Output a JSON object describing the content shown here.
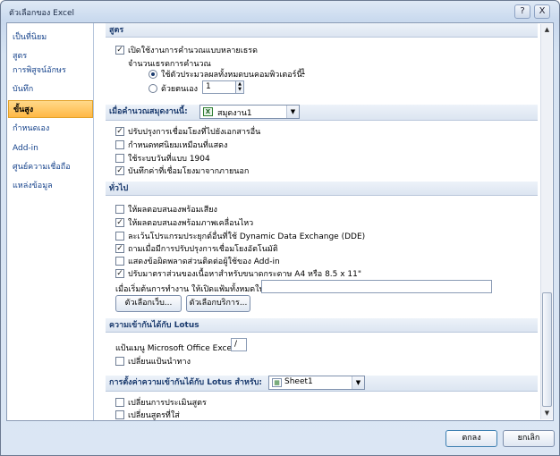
{
  "window": {
    "title": "ตัวเลือกของ Excel",
    "help_glyph": "?",
    "close_glyph": "X"
  },
  "sidebar": {
    "items": [
      {
        "label": "เป็นที่นิยม"
      },
      {
        "label": "สูตร"
      },
      {
        "label": "การพิสูจน์อักษร"
      },
      {
        "label": "บันทึก"
      },
      {
        "label": "ขั้นสูง"
      },
      {
        "label": "กำหนดเอง"
      },
      {
        "label": "Add-in"
      },
      {
        "label": "ศูนย์ความเชื่อถือ"
      },
      {
        "label": "แหล่งข้อมูล"
      }
    ],
    "selected": "ขั้นสูง"
  },
  "formulas": {
    "header": "สูตร",
    "multithread_label": "เปิดใช้งานการคำนวณแบบหลายเธรด",
    "multithread_checked": true,
    "threads_label": "จำนวนเธรดการคำนวณ",
    "use_all_label": "ใช้ตัวประมวลผลทั้งหมดบนคอมพิวเตอร์นี้:",
    "use_all_value": "1",
    "manual_label": "ด้วยตนเอง",
    "manual_value": "1"
  },
  "calc_workbook": {
    "header": "เมื่อคำนวณสมุดงานนี้:",
    "workbook_value": "สมุดงาน1",
    "options": [
      {
        "label": "ปรับปรุงการเชื่อมโยงที่ไปยังเอกสารอื่น",
        "checked": true
      },
      {
        "label": "กำหนดทศนิยมเหมือนที่แสดง",
        "checked": false
      },
      {
        "label": "ใช้ระบบวันที่แบบ 1904",
        "checked": false
      },
      {
        "label": "บันทึกค่าที่เชื่อมโยงมาจากภายนอก",
        "checked": true
      }
    ]
  },
  "general": {
    "header": "ทั่วไป",
    "options": [
      {
        "label": "ให้ผลตอบสนองพร้อมเสียง",
        "checked": false
      },
      {
        "label": "ให้ผลตอบสนองพร้อมภาพเคลื่อนไหว",
        "checked": true
      },
      {
        "label": "ละเว้นโปรแกรมประยุกต์อื่นที่ใช้ Dynamic Data Exchange (DDE)",
        "checked": false
      },
      {
        "label": "ถามเมื่อมีการปรับปรุงการเชื่อมโยงอัตโนมัติ",
        "checked": true
      },
      {
        "label": "แสดงข้อผิดพลาดส่วนติดต่อผู้ใช้ของ Add-in",
        "checked": false
      },
      {
        "label": "ปรับมาตราส่วนของเนื้อหาสำหรับขนาดกระดาษ A4 หรือ 8.5 x 11\"",
        "checked": true
      }
    ],
    "startup_label": "เมื่อเริ่มต้นการทำงาน ให้เปิดแฟ้มทั้งหมดใน:",
    "startup_value": "",
    "web_options_button": "ตัวเลือกเว็บ...",
    "service_options_button": "ตัวเลือกบริการ..."
  },
  "lotus": {
    "header": "ความเข้ากันได้กับ Lotus",
    "menu_key_label": "แป้นเมนู Microsoft Office Excel:",
    "menu_key_value": "/",
    "nav_keys_label": "เปลี่ยนแป้นนำทาง",
    "nav_keys_checked": false
  },
  "lotus_settings": {
    "header": "การตั้งค่าความเข้ากันได้กับ Lotus สำหรับ:",
    "sheet_value": "Sheet1",
    "options": [
      {
        "label": "เปลี่ยนการประเมินสูตร",
        "checked": false
      },
      {
        "label": "เปลี่ยนสูตรที่ใส่",
        "checked": false
      }
    ]
  },
  "footer": {
    "ok_label": "ตกลง",
    "cancel_label": "ยกเลิก"
  },
  "icons": {
    "workbook": "excel-workbook-icon",
    "sheet": "excel-sheet-icon",
    "dropdown": "chevron-down-icon"
  },
  "colors": {
    "selected_nav": "#ffc45c",
    "header_text": "#1b3b6e",
    "nav_text": "#15428b"
  }
}
